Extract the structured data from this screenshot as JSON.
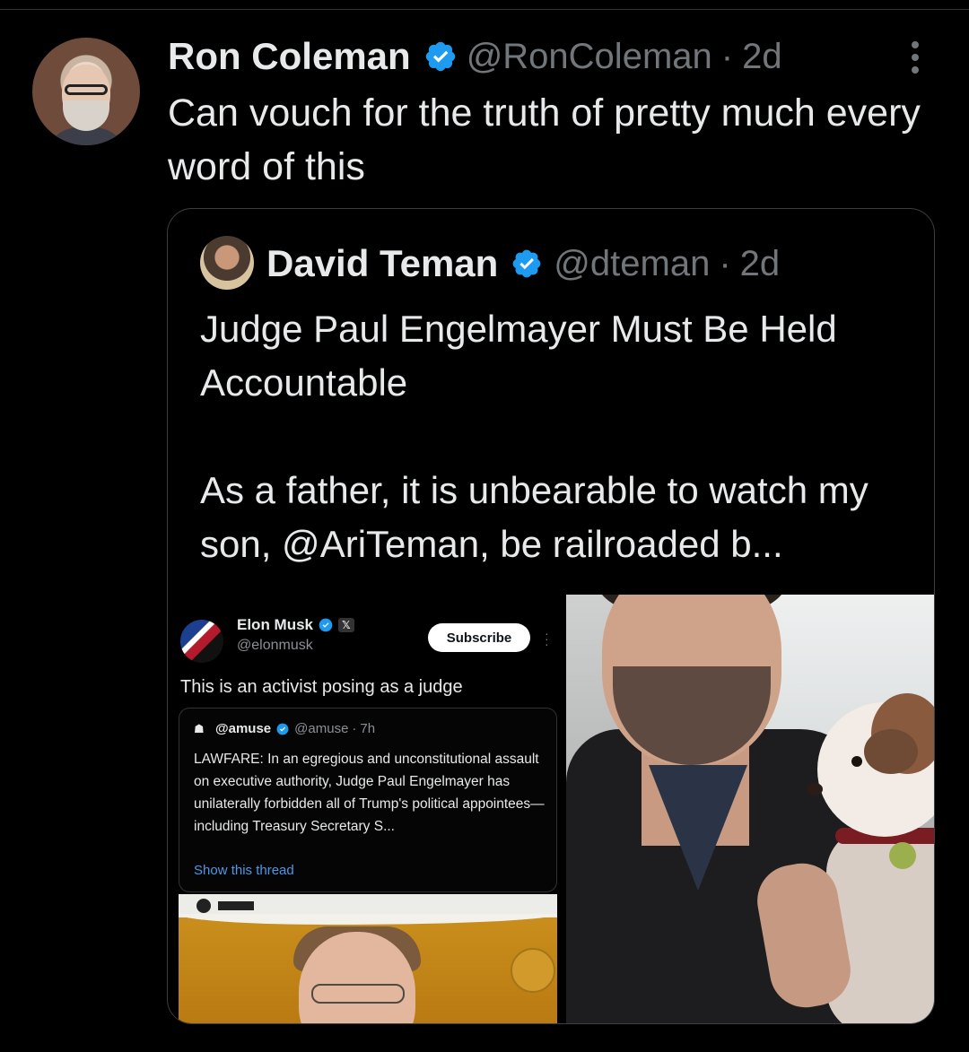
{
  "tweet": {
    "author_name": "Ron Coleman",
    "author_handle": "@RonColeman",
    "separator": "·",
    "time": "2d",
    "text": "Can vouch for the truth of pretty much every word of this",
    "verified_color": "#1d9bf0"
  },
  "quoted": {
    "author_name": "David Teman",
    "author_handle": "@dteman",
    "separator": "·",
    "time": "2d",
    "title": "Judge Paul Engelmayer Must Be Held Accountable",
    "body": "As a father, it is unbearable to watch my son, @AriTeman, be railroaded b..."
  },
  "embedded_screenshot": {
    "name": "Elon Musk",
    "x_badge": "𝕏",
    "handle": "@elonmusk",
    "subscribe_label": "Subscribe",
    "post_text": "This is an activist posing as a judge",
    "inner": {
      "name": "@amuse",
      "handle": "@amuse",
      "separator": "·",
      "time": "7h",
      "text": "LAWFARE: In an egregious and unconstitutional assault on executive authority, Judge Paul Engelmayer has unilaterally forbidden all of Trump's political appointees—including Treasury Secretary S...",
      "link": "Show this thread"
    }
  },
  "colors": {
    "background": "#000000",
    "text_primary": "#e7e9ea",
    "text_secondary": "#71767b",
    "link": "#4a99e9",
    "border": "#2f3336"
  },
  "icons": {
    "verified": "verified-badge-icon",
    "more": "more-options-icon"
  }
}
